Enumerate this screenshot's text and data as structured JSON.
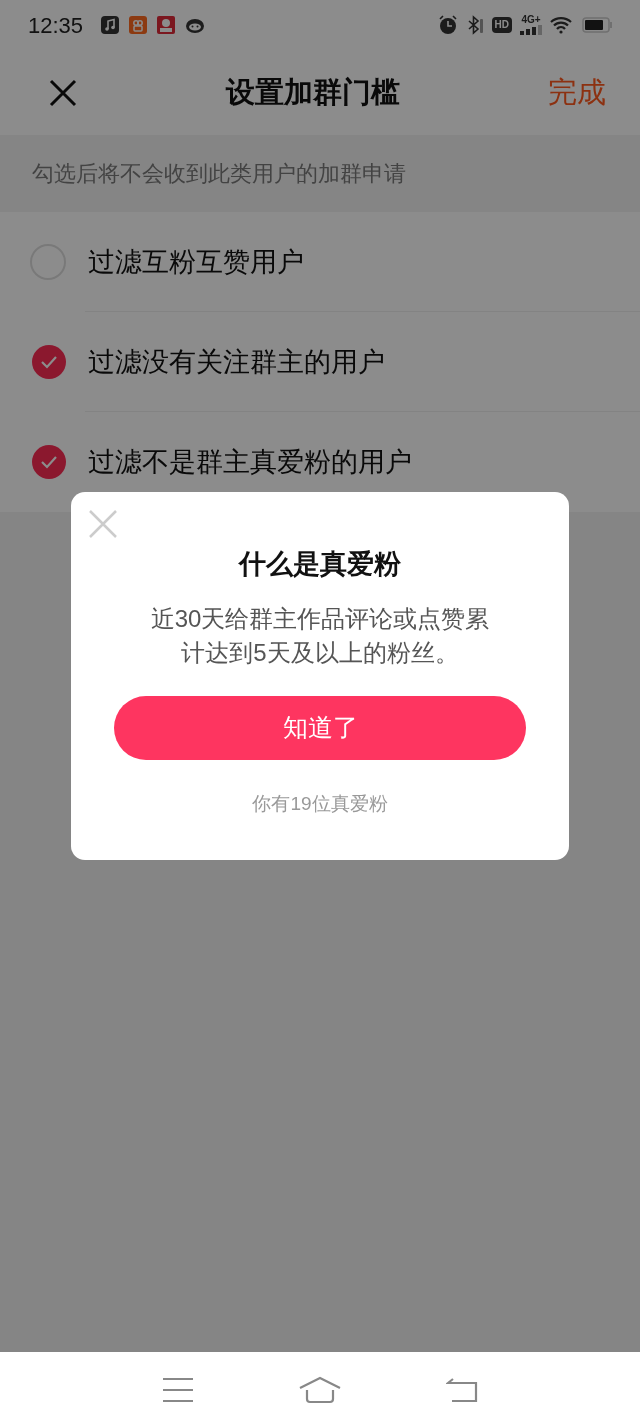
{
  "status_bar": {
    "time": "12:35",
    "hd": "HD",
    "network": "4G+"
  },
  "header": {
    "title": "设置加群门槛",
    "done": "完成"
  },
  "hint": "勾选后将不会收到此类用户的加群申请",
  "options": [
    {
      "label": "过滤互粉互赞用户",
      "checked": false
    },
    {
      "label": "过滤没有关注群主的用户",
      "checked": true
    },
    {
      "label": "过滤不是群主真爱粉的用户",
      "checked": true
    }
  ],
  "dialog": {
    "title": "什么是真爱粉",
    "body": "近30天给群主作品评论或点赞累计达到5天及以上的粉丝。",
    "button": "知道了",
    "footer": "你有19位真爱粉"
  }
}
